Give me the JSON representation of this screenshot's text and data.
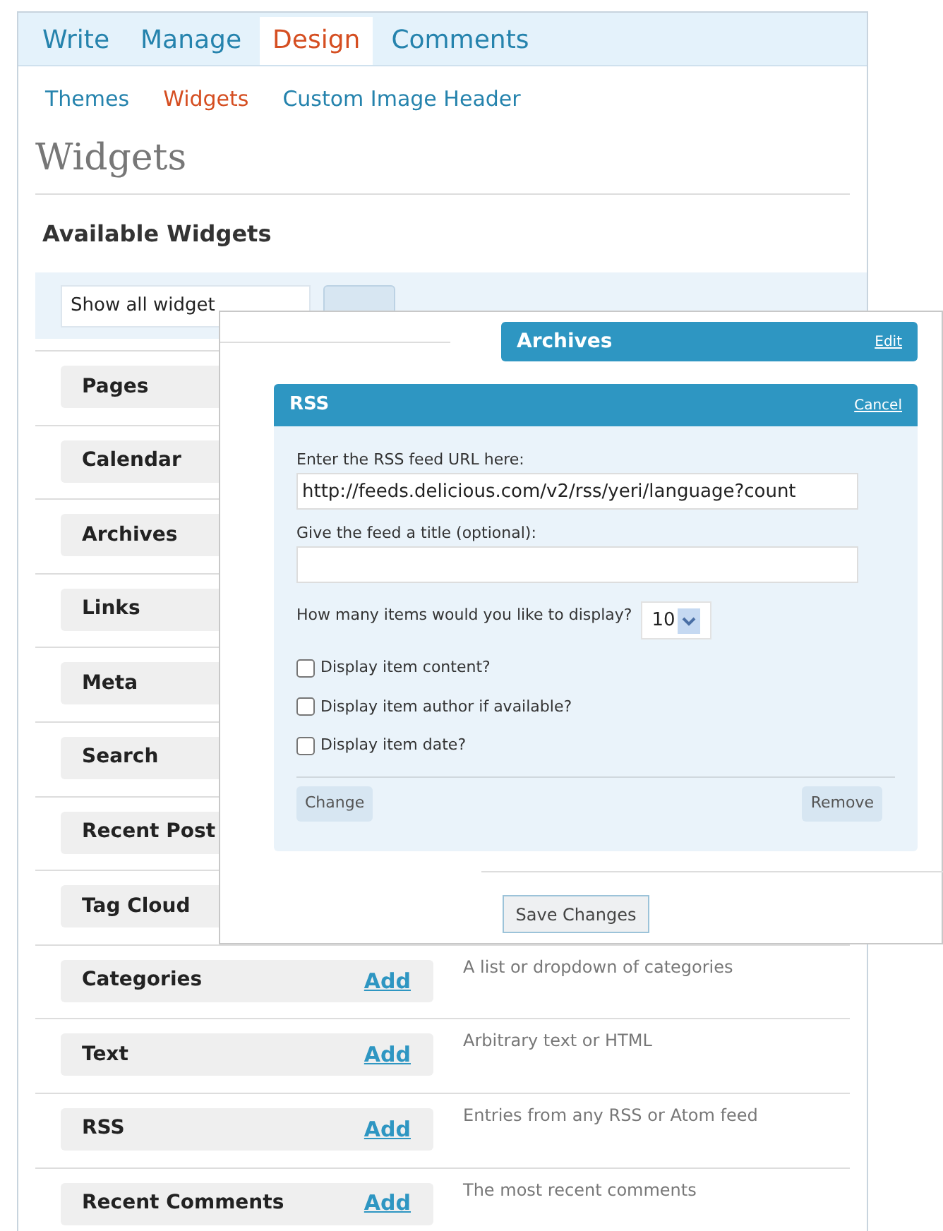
{
  "tabs": [
    {
      "label": "Write",
      "selected": false
    },
    {
      "label": "Manage",
      "selected": false
    },
    {
      "label": "Design",
      "selected": true
    },
    {
      "label": "Comments",
      "selected": false
    }
  ],
  "subtabs": [
    {
      "label": "Themes",
      "selected": false
    },
    {
      "label": "Widgets",
      "selected": true
    },
    {
      "label": "Custom Image Header",
      "selected": false
    }
  ],
  "page_title": "Widgets",
  "section_heading": "Available Widgets",
  "filter": {
    "value": "Show all widget"
  },
  "widgets": [
    {
      "name": "Pages"
    },
    {
      "name": "Calendar"
    },
    {
      "name": "Archives"
    },
    {
      "name": "Links"
    },
    {
      "name": "Meta"
    },
    {
      "name": "Search"
    },
    {
      "name": "Recent Post"
    },
    {
      "name": "Tag Cloud"
    },
    {
      "name": "Categories",
      "action": "Add",
      "description": "A list or dropdown of categories"
    },
    {
      "name": "Text",
      "action": "Add",
      "description": "Arbitrary text or HTML"
    },
    {
      "name": "RSS",
      "action": "Add",
      "description": "Entries from any RSS or Atom feed"
    },
    {
      "name": "Recent Comments",
      "action": "Add",
      "description": "The most recent comments"
    }
  ],
  "sidebar_widget": {
    "title": "Archives",
    "link": "Edit"
  },
  "rss_widget": {
    "title": "RSS",
    "link": "Cancel",
    "url_label": "Enter the RSS feed URL here:",
    "url_value": "http://feeds.delicious.com/v2/rss/yeri/language?count",
    "title_label": "Give the feed a title (optional):",
    "count_label": "How many items would you like to display?",
    "count_value": "10",
    "options": [
      {
        "label": "Display item content?",
        "checked": false
      },
      {
        "label": "Display item author if available?",
        "checked": false
      },
      {
        "label": "Display item date?",
        "checked": false
      }
    ],
    "buttons": [
      "Change",
      "Remove"
    ]
  },
  "save_button": "Save Changes"
}
